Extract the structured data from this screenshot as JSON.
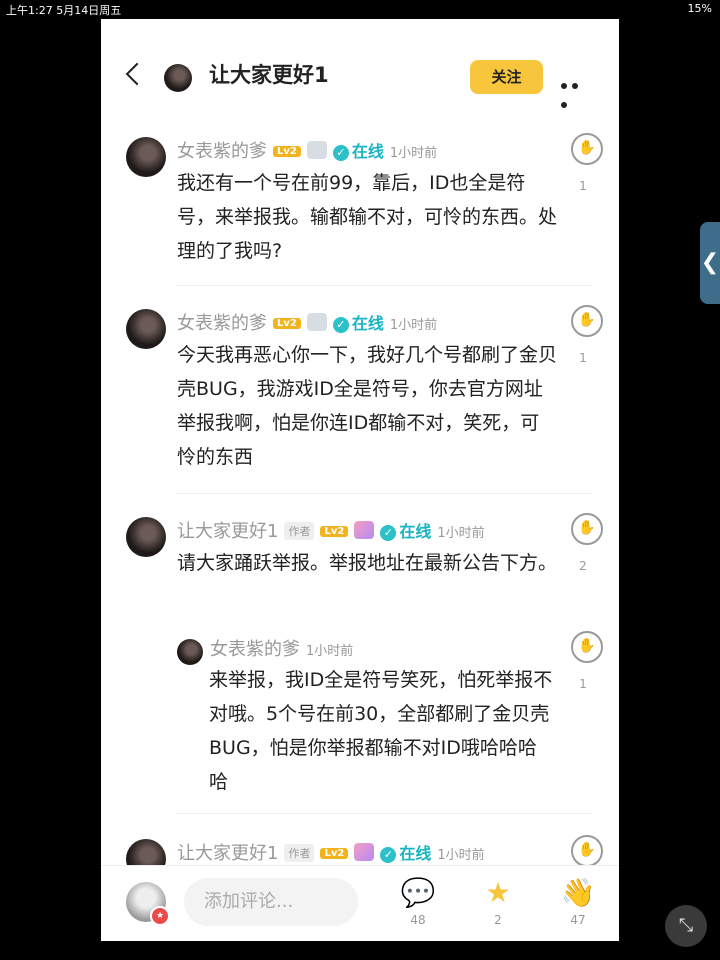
{
  "status": {
    "left": "上午1:27   5月14日周五",
    "right": "15%"
  },
  "header": {
    "title": "让大家更好1",
    "follow_label": "关注"
  },
  "comments": [
    {
      "name": "女表紫的爹",
      "level": "Lv2",
      "online": "在线",
      "time": "1小时前",
      "text": "我还有一个号在前99，靠后，ID也全是符号，来举报我。输都输不对，可怜的东西。处理的了我吗?",
      "likes": "1"
    },
    {
      "name": "女表紫的爹",
      "level": "Lv2",
      "online": "在线",
      "time": "1小时前",
      "text": "今天我再恶心你一下，我好几个号都刷了金贝壳BUG，我游戏ID全是符号，你去官方网址举报我啊，怕是你连ID都输不对，笑死，可怜的东西",
      "likes": "1"
    },
    {
      "name": "让大家更好1",
      "author_tag": "作者",
      "level": "Lv2",
      "online": "在线",
      "time": "1小时前",
      "text": "请大家踊跃举报。举报地址在最新公告下方。",
      "likes": "2",
      "reply": {
        "name": "女表紫的爹",
        "time": "1小时前",
        "text": "来举报，我ID全是符号笑死，怕死举报不对哦。5个号在前30，全部都刷了金贝壳BUG，怕是你举报都输不对ID哦哈哈哈哈",
        "likes": "1"
      }
    },
    {
      "name": "让大家更好1",
      "author_tag": "作者",
      "level": "Lv2",
      "online": "在线",
      "time": "1小时前"
    }
  ],
  "bottom_bar": {
    "placeholder": "添加评论...",
    "comments_count": "48",
    "stars_count": "2",
    "claps_count": "47"
  },
  "colors": {
    "accent": "#f7c63d",
    "online": "#19b4c3"
  },
  "icons": [
    "back-icon",
    "more-icon",
    "clap-icon",
    "comment-icon",
    "star-icon",
    "shrink-icon",
    "side-tab-icon"
  ]
}
